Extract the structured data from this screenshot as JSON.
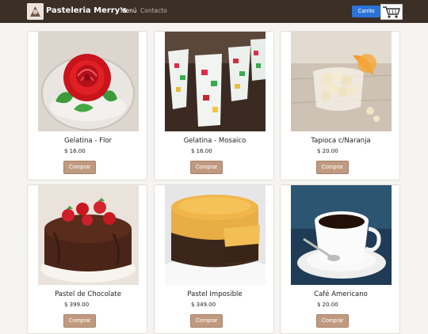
{
  "header": {
    "brand": "Pasteleria Merry's",
    "nav": [
      {
        "label": "Menú"
      },
      {
        "label": "Contacto"
      }
    ],
    "cart_label": "Carrito"
  },
  "products": [
    {
      "name": "Gelatina - Flor",
      "price": "$ 16.00",
      "button": "Comprar"
    },
    {
      "name": "Gelatina - Mosaico",
      "price": "$ 16.00",
      "button": "Comprar"
    },
    {
      "name": "Tapioca c/Naranja",
      "price": "$ 20.00",
      "button": "Comprar"
    },
    {
      "name": "Pastel de Chocolate",
      "price": "$ 399.00",
      "button": "Comprar"
    },
    {
      "name": "Pastel Imposible",
      "price": "$ 349.00",
      "button": "Comprar"
    },
    {
      "name": "Café Americano",
      "price": "$ 20.00",
      "button": "Comprar"
    }
  ],
  "colors": {
    "navbar": "#3b2f26",
    "cart_button": "#2a73d9",
    "buy_button": "#c09a80"
  }
}
